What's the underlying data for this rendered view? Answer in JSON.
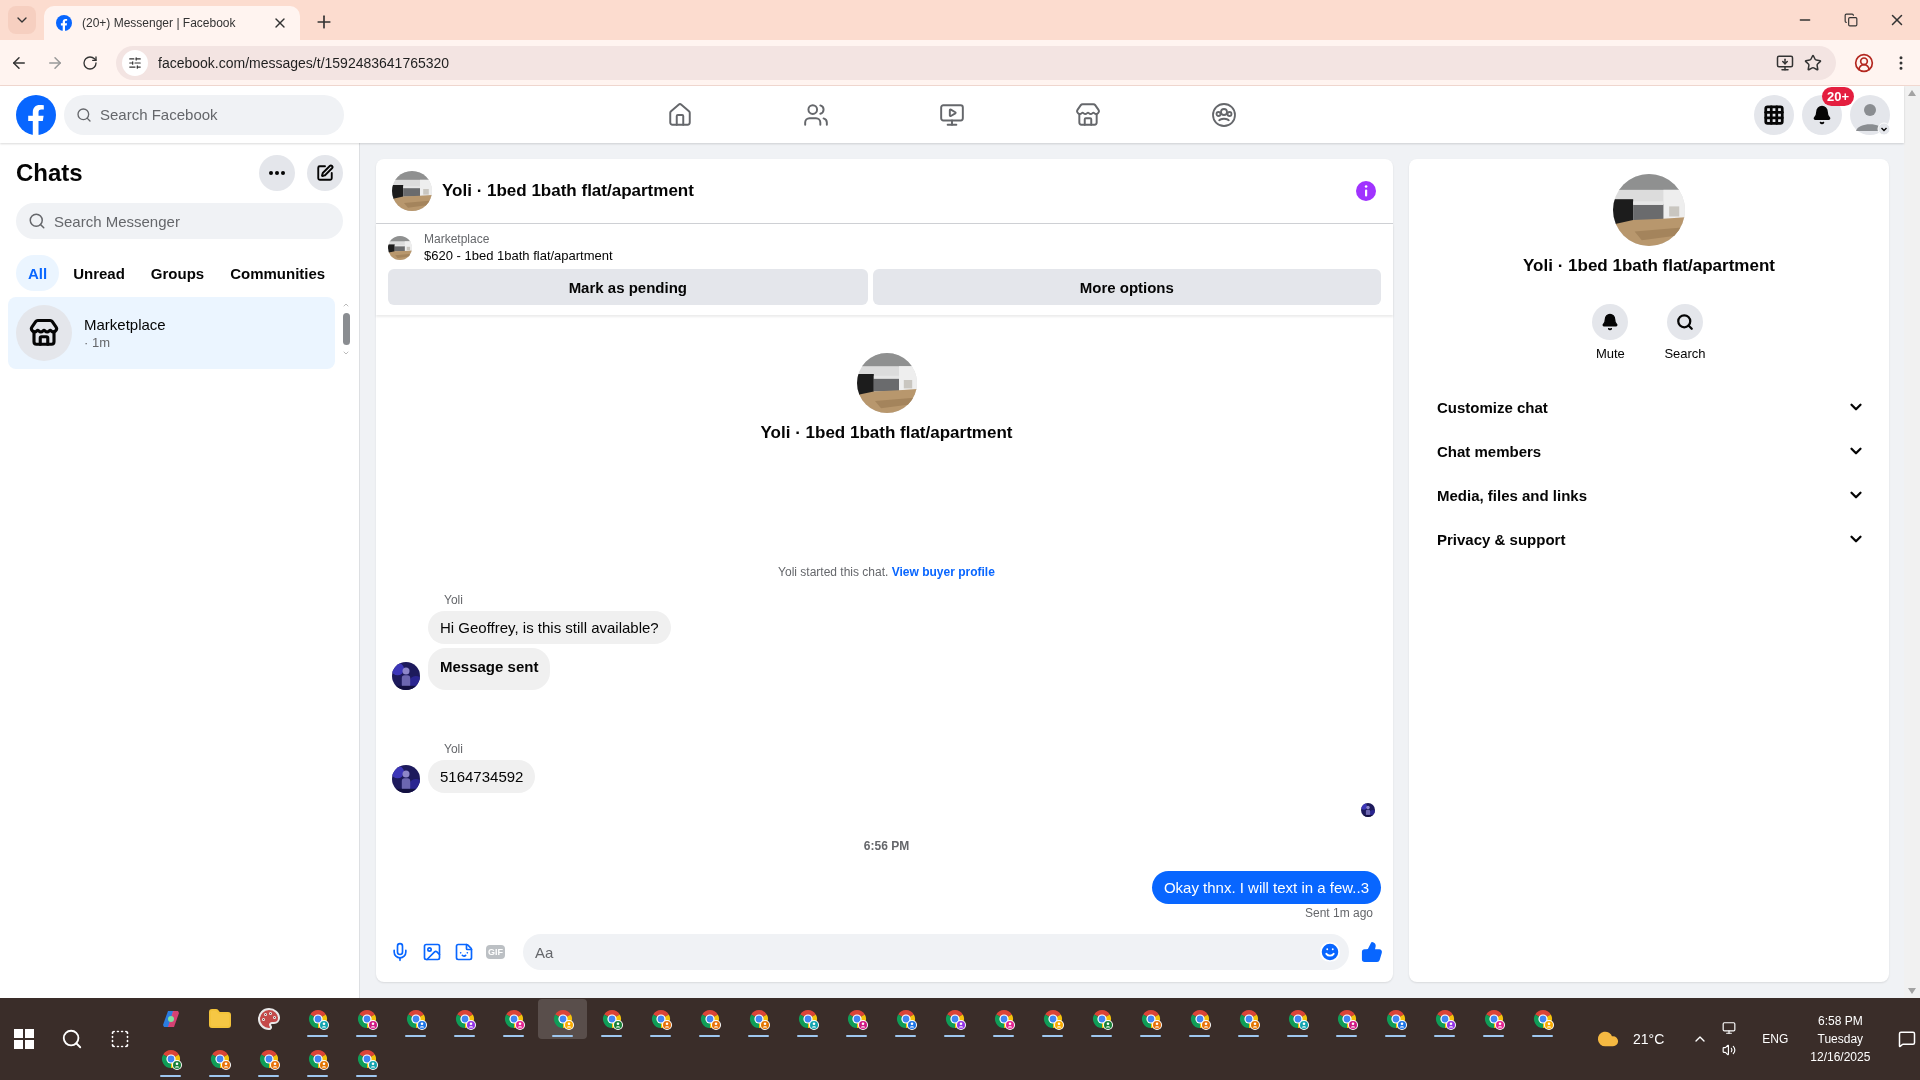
{
  "browser": {
    "tab_title": "(20+) Messenger | Facebook",
    "url": "facebook.com/messages/t/1592483641765320"
  },
  "header": {
    "search_placeholder": "Search Facebook",
    "notification_badge": "20+"
  },
  "sidebar": {
    "title": "Chats",
    "search_placeholder": "Search Messenger",
    "filters": [
      {
        "label": "All",
        "selected": true
      },
      {
        "label": "Unread",
        "selected": false
      },
      {
        "label": "Groups",
        "selected": false
      },
      {
        "label": "Communities",
        "selected": false
      }
    ],
    "conversations": [
      {
        "name": "Marketplace",
        "meta": "· 1m",
        "selected": true
      }
    ]
  },
  "chat": {
    "title": "Yoli · 1bed 1bath flat/apartment",
    "listing": {
      "label": "Marketplace",
      "detail": "$620 - 1bed 1bath flat/apartment"
    },
    "actions": [
      "Mark as pending",
      "More options"
    ],
    "intro_title": "Yoli · 1bed 1bath flat/apartment",
    "notice": {
      "text": "Yoli started this chat.",
      "link": "View buyer profile"
    },
    "messages": [
      {
        "kind": "group",
        "sender": "Yoli",
        "bubbles": [
          {
            "text": "Hi Geoffrey, is this still available?",
            "bold": false
          },
          {
            "text": "Message sent",
            "bold": true
          }
        ]
      },
      {
        "kind": "group",
        "sender": "Yoli",
        "bubbles": [
          {
            "text": "5164734592",
            "bold": false
          }
        ]
      },
      {
        "kind": "seen"
      },
      {
        "kind": "time",
        "text": "6:56 PM"
      },
      {
        "kind": "outgoing",
        "text": "Okay thnx. I will text in a few..3",
        "status": "Sent 1m ago"
      }
    ],
    "composer": {
      "placeholder": "Aa",
      "gif_label": "GIF"
    }
  },
  "details": {
    "title": "Yoli · 1bed 1bath flat/apartment",
    "actions": [
      {
        "kind": "mute",
        "label": "Mute"
      },
      {
        "kind": "search",
        "label": "Search"
      }
    ],
    "sections": [
      {
        "label": "Customize chat",
        "expanded": false
      },
      {
        "label": "Chat members",
        "expanded": false
      },
      {
        "label": "Media, files and links",
        "expanded": false
      },
      {
        "label": "Privacy & support",
        "expanded": false
      }
    ]
  },
  "taskbar": {
    "apps": [
      {
        "kind": "copilot",
        "selected": false
      },
      {
        "kind": "folder",
        "selected": false
      },
      {
        "kind": "paint",
        "selected": false
      },
      {
        "kind": "browser",
        "selected": false
      },
      {
        "kind": "browser",
        "selected": false
      },
      {
        "kind": "browser",
        "selected": false
      },
      {
        "kind": "browser",
        "selected": false
      },
      {
        "kind": "browser",
        "selected": false
      },
      {
        "kind": "browser",
        "selected": true
      },
      {
        "kind": "browser",
        "selected": false
      },
      {
        "kind": "browser",
        "selected": false
      },
      {
        "kind": "browser",
        "selected": false
      },
      {
        "kind": "browser",
        "selected": false
      },
      {
        "kind": "browser",
        "selected": false
      },
      {
        "kind": "browser",
        "selected": false
      },
      {
        "kind": "browser",
        "selected": false
      },
      {
        "kind": "browser",
        "selected": false
      },
      {
        "kind": "browser",
        "selected": false
      },
      {
        "kind": "browser",
        "selected": false
      },
      {
        "kind": "browser",
        "selected": false
      },
      {
        "kind": "browser",
        "selected": false
      },
      {
        "kind": "browser",
        "selected": false
      },
      {
        "kind": "browser",
        "selected": false
      },
      {
        "kind": "browser",
        "selected": false
      },
      {
        "kind": "browser",
        "selected": false
      },
      {
        "kind": "browser",
        "selected": false
      },
      {
        "kind": "browser",
        "selected": false
      },
      {
        "kind": "browser",
        "selected": false
      },
      {
        "kind": "browser",
        "selected": false
      },
      {
        "kind": "browser",
        "selected": false
      },
      {
        "kind": "browser",
        "selected": false
      },
      {
        "kind": "browser",
        "selected": false
      },
      {
        "kind": "browser",
        "selected": false
      },
      {
        "kind": "browser",
        "selected": false
      }
    ],
    "temperature": "21°C",
    "language": "ENG",
    "time": "6:58 PM",
    "day": "Tuesday",
    "date": "12/16/2025"
  }
}
